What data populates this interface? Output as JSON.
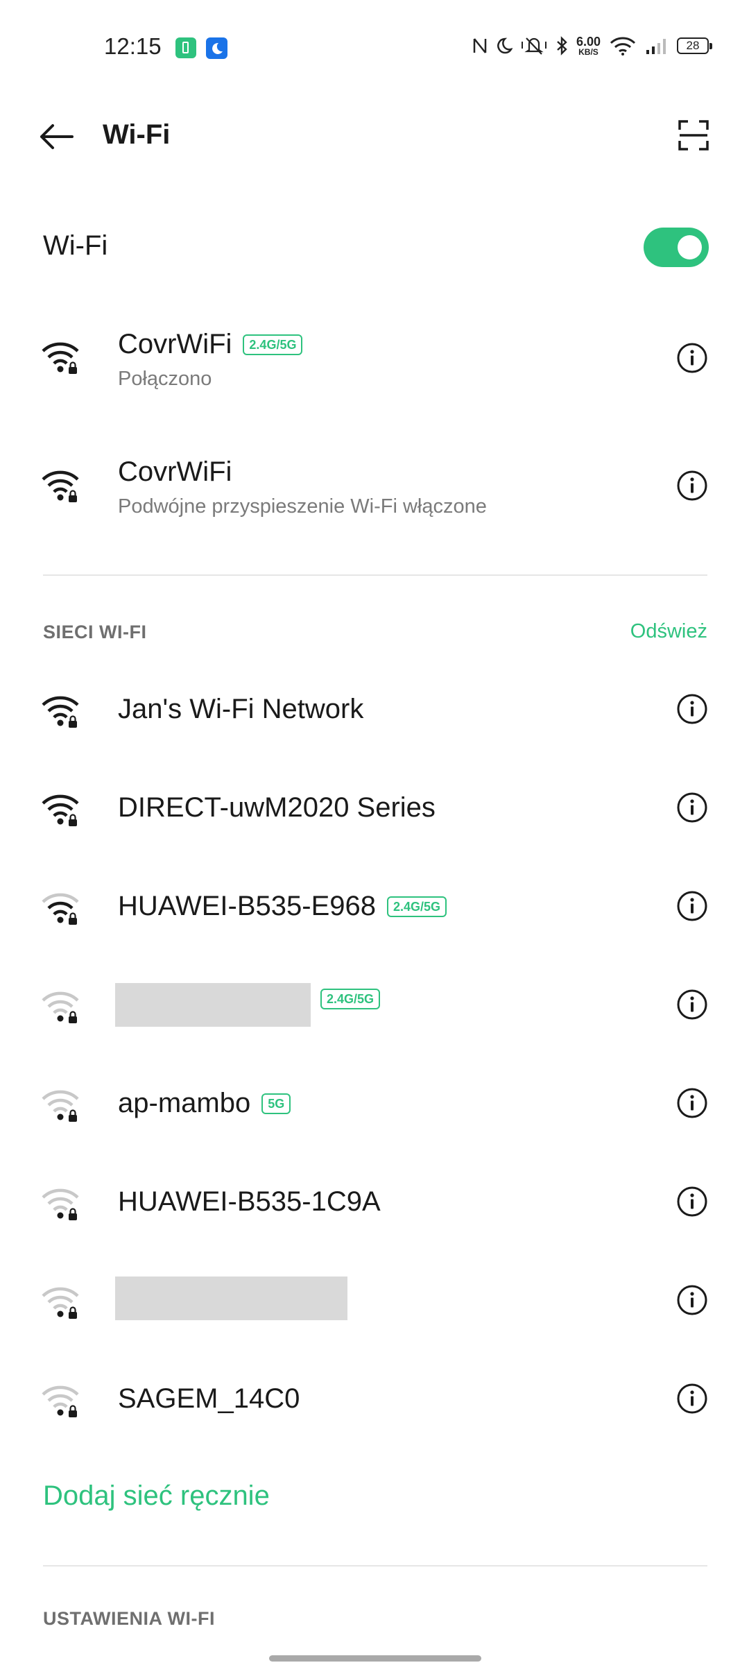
{
  "status_bar": {
    "time": "12:15",
    "speed_value": "6.00",
    "speed_unit": "KB/S",
    "battery": "28",
    "icons": [
      "battery-saver-app-icon",
      "moon-app-icon",
      "nfc-icon",
      "moon-icon",
      "bell-muted-icon",
      "bluetooth-icon",
      "wifi-icon",
      "cell-signal-icon",
      "battery-icon"
    ]
  },
  "header": {
    "title": "Wi-Fi"
  },
  "wifi_toggle": {
    "label": "Wi-Fi",
    "enabled": true
  },
  "saved_networks": [
    {
      "name": "CovrWiFi",
      "badge": "2.4G/5G",
      "status": "Połączono",
      "signal": 3
    },
    {
      "name": "CovrWiFi",
      "badge": "",
      "status": "Podwójne przyspieszenie Wi-Fi włączone",
      "signal": 3
    }
  ],
  "available_section": {
    "title": "SIECI WI-FI",
    "refresh": "Odśwież"
  },
  "networks": [
    {
      "name": "Jan's Wi-Fi Network",
      "badge": "",
      "signal": 3
    },
    {
      "name": "DIRECT-uwM2020 Series",
      "badge": "",
      "signal": 3
    },
    {
      "name": "HUAWEI-B535-E968",
      "badge": "2.4G/5G",
      "signal": 2
    },
    {
      "name": "",
      "badge": "2.4G/5G",
      "signal": 1,
      "redacted": true
    },
    {
      "name": "ap-mambo",
      "badge": "5G",
      "signal": 1
    },
    {
      "name": "HUAWEI-B535-1C9A",
      "badge": "",
      "signal": 1
    },
    {
      "name": "",
      "badge": "",
      "signal": 1,
      "redacted": true
    },
    {
      "name": "SAGEM_14C0",
      "badge": "",
      "signal": 1
    }
  ],
  "add_network": "Dodaj sieć ręcznie",
  "settings_section": {
    "title": "USTAWIENIA WI-FI"
  },
  "colors": {
    "accent": "#2ec27e",
    "text": "#1a1a1a",
    "muted": "#7a7a7a",
    "weak_signal": "#c8c8c8"
  }
}
